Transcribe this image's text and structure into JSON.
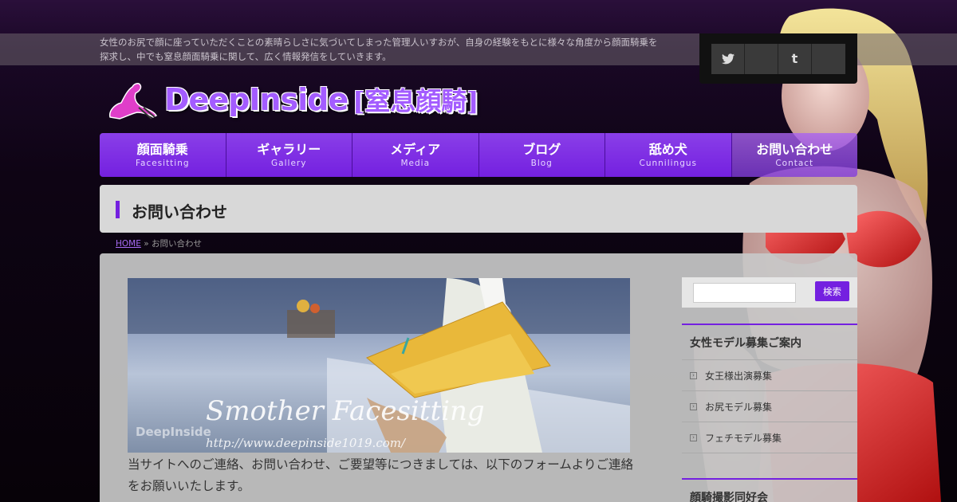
{
  "header": {
    "tagline": "女性のお尻で顔に座っていただくことの素晴らしさに気づいてしまった管理人いすおが、自身の経験をもとに様々な角度から顔面騎乗を探求し、中でも窒息顔面騎乗に関して、広く情報発信をしていきます。",
    "logo_text": "DeepInside",
    "logo_sub": "[窒息顔騎]"
  },
  "social": [
    "twitter-icon",
    "facebook-icon",
    "tumblr-icon",
    "rss-icon"
  ],
  "social_glyphs": {
    "twitter": "🐦",
    "facebook": "",
    "tumblr": "t",
    "rss": ""
  },
  "nav": [
    {
      "jp": "顔面騎乗",
      "en": "Facesitting"
    },
    {
      "jp": "ギャラリー",
      "en": "Gallery"
    },
    {
      "jp": "メディア",
      "en": "Media"
    },
    {
      "jp": "ブログ",
      "en": "Blog"
    },
    {
      "jp": "舐め犬",
      "en": "Cunnilingus"
    },
    {
      "jp": "お問い合わせ",
      "en": "Contact"
    }
  ],
  "page": {
    "title": "お問い合わせ",
    "breadcrumb_home": "HOME",
    "breadcrumb_sep": "»",
    "breadcrumb_current": "お問い合わせ"
  },
  "hero": {
    "caption": "Smother Facesitting",
    "url": "http://www.deepinside1019.com/",
    "watermark": "DeepInside"
  },
  "intro": "当サイトへのご連絡、お問い合わせ、ご要望等につきましては、以下のフォームよりご連絡をお願いいたします。",
  "search": {
    "button": "検索",
    "placeholder": ""
  },
  "widgets": {
    "model": {
      "title": "女性モデル募集ご案内",
      "items": [
        "女王様出演募集",
        "お尻モデル募集",
        "フェチモデル募集"
      ]
    },
    "club": {
      "title": "顔騎撮影同好会"
    }
  },
  "colors": {
    "accent": "#7420e0",
    "nav": "#8a3fe8",
    "background": "#0e0414"
  }
}
